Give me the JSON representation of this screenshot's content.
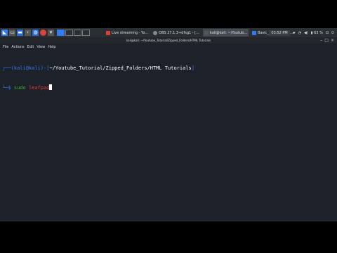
{
  "taskbar": {
    "workspaces": [
      "1",
      "2",
      "3",
      "4"
    ],
    "tasks": [
      {
        "label": "Live streaming - Yo...",
        "color": "#e23d3d",
        "active": false
      },
      {
        "label": "OBS 27.1.3+dfsg1 - [...",
        "color": "#8a8a8a",
        "active": false
      },
      {
        "label": "kali@kali: ~/Youtub...",
        "color": "#555555",
        "active": true
      },
      {
        "label": "Basic_Commands:...",
        "color": "#367bf0",
        "active": false
      }
    ],
    "clock": "03:52 PM",
    "battery": "63 %"
  },
  "window": {
    "title": "kali@kali: ~/Youtube_Tutorial/Zipped_Folders/HTML Tutorials"
  },
  "menu": [
    "File",
    "Actions",
    "Edit",
    "View",
    "Help"
  ],
  "terminal": {
    "prompt_user": "kali",
    "prompt_at": "@",
    "prompt_host": "kali",
    "prompt_path": "~/Youtube_Tutorial/Zipped_Folders/HTML Tutorials",
    "command": "sudo",
    "argument": "leafpad"
  }
}
